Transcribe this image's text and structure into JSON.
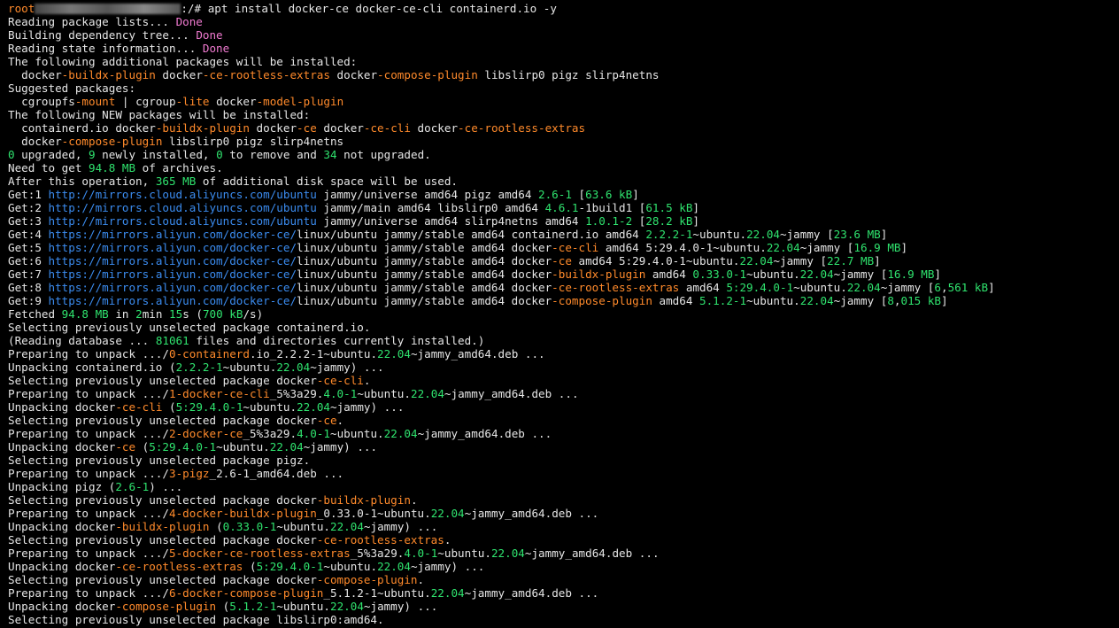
{
  "colors": {
    "background": "#000000",
    "text": "#e6e6e6",
    "orange": "#ff8a2b",
    "green": "#2fe36e",
    "blue": "#3b8cf0",
    "pink": "#f07ad0"
  },
  "prompt": {
    "user": "root",
    "suffix": ":/# ",
    "command": "apt install docker-ce docker-ce-cli containerd.io -y"
  },
  "lines": [
    [
      [
        "Reading package lists... ",
        "w"
      ],
      [
        "Done",
        "p"
      ]
    ],
    [
      [
        "Building dependency tree... ",
        "w"
      ],
      [
        "Done",
        "p"
      ]
    ],
    [
      [
        "Reading state information... ",
        "w"
      ],
      [
        "Done",
        "p"
      ]
    ],
    [
      [
        "The following additional packages will be installed:",
        "w"
      ]
    ],
    [
      [
        "  docker",
        "w"
      ],
      [
        "-buildx-plugin",
        "o"
      ],
      [
        " docker",
        "w"
      ],
      [
        "-ce-rootless-extras",
        "o"
      ],
      [
        " docker",
        "w"
      ],
      [
        "-compose-plugin",
        "o"
      ],
      [
        " libslirp0 pigz slirp4netns",
        "w"
      ]
    ],
    [
      [
        "Suggested packages:",
        "w"
      ]
    ],
    [
      [
        "  cgroupfs",
        "w"
      ],
      [
        "-mount",
        "o"
      ],
      [
        " | cgroup",
        "w"
      ],
      [
        "-lite",
        "o"
      ],
      [
        " docker",
        "w"
      ],
      [
        "-model-plugin",
        "o"
      ]
    ],
    [
      [
        "The following NEW packages will be installed:",
        "w"
      ]
    ],
    [
      [
        "  containerd.io docker",
        "w"
      ],
      [
        "-buildx-plugin",
        "o"
      ],
      [
        " docker",
        "w"
      ],
      [
        "-ce",
        "o"
      ],
      [
        " docker",
        "w"
      ],
      [
        "-ce-cli",
        "o"
      ],
      [
        " docker",
        "w"
      ],
      [
        "-ce-rootless-extras",
        "o"
      ]
    ],
    [
      [
        "  docker",
        "w"
      ],
      [
        "-compose-plugin",
        "o"
      ],
      [
        " libslirp0 pigz slirp4netns",
        "w"
      ]
    ],
    [
      [
        "0",
        "g"
      ],
      [
        " upgraded, ",
        "w"
      ],
      [
        "9",
        "g"
      ],
      [
        " newly installed, ",
        "w"
      ],
      [
        "0",
        "g"
      ],
      [
        " to remove and ",
        "w"
      ],
      [
        "34",
        "g"
      ],
      [
        " not upgraded.",
        "w"
      ]
    ],
    [
      [
        "Need to get ",
        "w"
      ],
      [
        "94.8 MB",
        "g"
      ],
      [
        " of archives.",
        "w"
      ]
    ],
    [
      [
        "After this operation, ",
        "w"
      ],
      [
        "365 MB",
        "g"
      ],
      [
        " of additional disk space will be used.",
        "w"
      ]
    ],
    [
      [
        "Get:1 ",
        "w"
      ],
      [
        "http://mirrors.cloud.aliyuncs.com/ubuntu",
        "b"
      ],
      [
        " jammy/universe amd64 pigz amd64 ",
        "w"
      ],
      [
        "2.6-1",
        "g"
      ],
      [
        " [",
        "w"
      ],
      [
        "63.6 kB",
        "g"
      ],
      [
        "]",
        "w"
      ]
    ],
    [
      [
        "Get:2 ",
        "w"
      ],
      [
        "http://mirrors.cloud.aliyuncs.com/ubuntu",
        "b"
      ],
      [
        " jammy/main amd64 libslirp0 amd64 ",
        "w"
      ],
      [
        "4.6.1",
        "g"
      ],
      [
        "-1build1 [",
        "w"
      ],
      [
        "61.5 kB",
        "g"
      ],
      [
        "]",
        "w"
      ]
    ],
    [
      [
        "Get:3 ",
        "w"
      ],
      [
        "http://mirrors.cloud.aliyuncs.com/ubuntu",
        "b"
      ],
      [
        " jammy/universe amd64 slirp4netns amd64 ",
        "w"
      ],
      [
        "1.0.1-2",
        "g"
      ],
      [
        " [",
        "w"
      ],
      [
        "28.2 kB",
        "g"
      ],
      [
        "]",
        "w"
      ]
    ],
    [
      [
        "Get:4 ",
        "w"
      ],
      [
        "https://mirrors.aliyun.com/docker-ce/",
        "b"
      ],
      [
        "linux/ubuntu jammy/stable amd64 containerd.io amd64 ",
        "w"
      ],
      [
        "2.2.2-1",
        "g"
      ],
      [
        "~ubuntu.",
        "w"
      ],
      [
        "22.04",
        "g"
      ],
      [
        "~jammy [",
        "w"
      ],
      [
        "23.6 MB",
        "g"
      ],
      [
        "]",
        "w"
      ]
    ],
    [
      [
        "Get:5 ",
        "w"
      ],
      [
        "https://mirrors.aliyun.com/docker-ce/",
        "b"
      ],
      [
        "linux/ubuntu jammy/stable amd64 docker",
        "w"
      ],
      [
        "-ce-cli",
        "o"
      ],
      [
        " amd64 5:29.4.0-1~ubuntu.",
        "w"
      ],
      [
        "22.04",
        "g"
      ],
      [
        "~jammy [",
        "w"
      ],
      [
        "16.9 MB",
        "g"
      ],
      [
        "]",
        "w"
      ]
    ],
    [
      [
        "Get:6 ",
        "w"
      ],
      [
        "https://mirrors.aliyun.com/docker-ce/",
        "b"
      ],
      [
        "linux/ubuntu jammy/stable amd64 docker",
        "w"
      ],
      [
        "-ce",
        "o"
      ],
      [
        " amd64 5:29.4.0-1~ubuntu.",
        "w"
      ],
      [
        "22.04",
        "g"
      ],
      [
        "~jammy [",
        "w"
      ],
      [
        "22.7 MB",
        "g"
      ],
      [
        "]",
        "w"
      ]
    ],
    [
      [
        "Get:7 ",
        "w"
      ],
      [
        "https://mirrors.aliyun.com/docker-ce/",
        "b"
      ],
      [
        "linux/ubuntu jammy/stable amd64 docker",
        "w"
      ],
      [
        "-buildx-plugin",
        "o"
      ],
      [
        " amd64 ",
        "w"
      ],
      [
        "0.33.0-1",
        "g"
      ],
      [
        "~ubuntu.",
        "w"
      ],
      [
        "22.04",
        "g"
      ],
      [
        "~jammy [",
        "w"
      ],
      [
        "16.9 MB",
        "g"
      ],
      [
        "]",
        "w"
      ]
    ],
    [
      [
        "Get:8 ",
        "w"
      ],
      [
        "https://mirrors.aliyun.com/docker-ce/",
        "b"
      ],
      [
        "linux/ubuntu jammy/stable amd64 docker",
        "w"
      ],
      [
        "-ce-rootless-extras",
        "o"
      ],
      [
        " amd64 ",
        "w"
      ],
      [
        "5:29.4.0-1",
        "g"
      ],
      [
        "~ubuntu.",
        "w"
      ],
      [
        "22.04",
        "g"
      ],
      [
        "~jammy [",
        "w"
      ],
      [
        "6",
        "g"
      ],
      [
        ",",
        "w"
      ],
      [
        "561 kB",
        "g"
      ],
      [
        "]",
        "w"
      ]
    ],
    [
      [
        "Get:9 ",
        "w"
      ],
      [
        "https://mirrors.aliyun.com/docker-ce/",
        "b"
      ],
      [
        "linux/ubuntu jammy/stable amd64 docker",
        "w"
      ],
      [
        "-compose-plugin",
        "o"
      ],
      [
        " amd64 ",
        "w"
      ],
      [
        "5.1.2-1",
        "g"
      ],
      [
        "~ubuntu.",
        "w"
      ],
      [
        "22.04",
        "g"
      ],
      [
        "~jammy [",
        "w"
      ],
      [
        "8",
        "g"
      ],
      [
        ",",
        "w"
      ],
      [
        "015 kB",
        "g"
      ],
      [
        "]",
        "w"
      ]
    ],
    [
      [
        "Fetched ",
        "w"
      ],
      [
        "94.8 MB",
        "g"
      ],
      [
        " in ",
        "w"
      ],
      [
        "2",
        "g"
      ],
      [
        "min ",
        "w"
      ],
      [
        "15",
        "g"
      ],
      [
        "s (",
        "w"
      ],
      [
        "700 kB",
        "g"
      ],
      [
        "/s)",
        "w"
      ]
    ],
    [
      [
        "Selecting previously unselected package containerd.io.",
        "w"
      ]
    ],
    [
      [
        "(Reading database ... ",
        "w"
      ],
      [
        "81061",
        "g"
      ],
      [
        " files and directories currently installed.)",
        "w"
      ]
    ],
    [
      [
        "Preparing to unpack .../",
        "w"
      ],
      [
        "0-containerd",
        "o"
      ],
      [
        ".io_2.2.2-1~ubuntu.",
        "w"
      ],
      [
        "22.04",
        "g"
      ],
      [
        "~jammy_amd64.deb ...",
        "w"
      ]
    ],
    [
      [
        "Unpacking containerd.io (",
        "w"
      ],
      [
        "2.2.2-1",
        "g"
      ],
      [
        "~ubuntu.",
        "w"
      ],
      [
        "22.04",
        "g"
      ],
      [
        "~jammy) ...",
        "w"
      ]
    ],
    [
      [
        "Selecting previously unselected package docker",
        "w"
      ],
      [
        "-ce-cli",
        "o"
      ],
      [
        ".",
        "w"
      ]
    ],
    [
      [
        "Preparing to unpack .../",
        "w"
      ],
      [
        "1-docker-ce-cli",
        "o"
      ],
      [
        "_5%3a29.",
        "w"
      ],
      [
        "4.0-1",
        "g"
      ],
      [
        "~ubuntu.",
        "w"
      ],
      [
        "22.04",
        "g"
      ],
      [
        "~jammy_amd64.deb ...",
        "w"
      ]
    ],
    [
      [
        "Unpacking docker",
        "w"
      ],
      [
        "-ce-cli",
        "o"
      ],
      [
        " (",
        "w"
      ],
      [
        "5:29.4.0-1",
        "g"
      ],
      [
        "~ubuntu.",
        "w"
      ],
      [
        "22.04",
        "g"
      ],
      [
        "~jammy) ...",
        "w"
      ]
    ],
    [
      [
        "Selecting previously unselected package docker",
        "w"
      ],
      [
        "-ce",
        "o"
      ],
      [
        ".",
        "w"
      ]
    ],
    [
      [
        "Preparing to unpack .../",
        "w"
      ],
      [
        "2-docker-ce",
        "o"
      ],
      [
        "_5%3a29.",
        "w"
      ],
      [
        "4.0-1",
        "g"
      ],
      [
        "~ubuntu.",
        "w"
      ],
      [
        "22.04",
        "g"
      ],
      [
        "~jammy_amd64.deb ...",
        "w"
      ]
    ],
    [
      [
        "Unpacking docker",
        "w"
      ],
      [
        "-ce",
        "o"
      ],
      [
        " (",
        "w"
      ],
      [
        "5:29.4.0-1",
        "g"
      ],
      [
        "~ubuntu.",
        "w"
      ],
      [
        "22.04",
        "g"
      ],
      [
        "~jammy) ...",
        "w"
      ]
    ],
    [
      [
        "Selecting previously unselected package pigz.",
        "w"
      ]
    ],
    [
      [
        "Preparing to unpack .../",
        "w"
      ],
      [
        "3-pigz",
        "o"
      ],
      [
        "_2.6-1_amd64.deb ...",
        "w"
      ]
    ],
    [
      [
        "Unpacking pigz (",
        "w"
      ],
      [
        "2.6-1",
        "g"
      ],
      [
        ") ...",
        "w"
      ]
    ],
    [
      [
        "Selecting previously unselected package docker",
        "w"
      ],
      [
        "-buildx-plugin",
        "o"
      ],
      [
        ".",
        "w"
      ]
    ],
    [
      [
        "Preparing to unpack .../",
        "w"
      ],
      [
        "4-docker-buildx-plugin",
        "o"
      ],
      [
        "_0.33.0-1~ubuntu.",
        "w"
      ],
      [
        "22.04",
        "g"
      ],
      [
        "~jammy_amd64.deb ...",
        "w"
      ]
    ],
    [
      [
        "Unpacking docker",
        "w"
      ],
      [
        "-buildx-plugin",
        "o"
      ],
      [
        " (",
        "w"
      ],
      [
        "0.33.0-1",
        "g"
      ],
      [
        "~ubuntu.",
        "w"
      ],
      [
        "22.04",
        "g"
      ],
      [
        "~jammy) ...",
        "w"
      ]
    ],
    [
      [
        "Selecting previously unselected package docker",
        "w"
      ],
      [
        "-ce-rootless-extras",
        "o"
      ],
      [
        ".",
        "w"
      ]
    ],
    [
      [
        "Preparing to unpack .../",
        "w"
      ],
      [
        "5-docker-ce-rootless-extras",
        "o"
      ],
      [
        "_5%3a29.",
        "w"
      ],
      [
        "4.0-1",
        "g"
      ],
      [
        "~ubuntu.",
        "w"
      ],
      [
        "22.04",
        "g"
      ],
      [
        "~jammy_amd64.deb ...",
        "w"
      ]
    ],
    [
      [
        "Unpacking docker",
        "w"
      ],
      [
        "-ce-rootless-extras",
        "o"
      ],
      [
        " (",
        "w"
      ],
      [
        "5:29.4.0-1",
        "g"
      ],
      [
        "~ubuntu.",
        "w"
      ],
      [
        "22.04",
        "g"
      ],
      [
        "~jammy) ...",
        "w"
      ]
    ],
    [
      [
        "Selecting previously unselected package docker",
        "w"
      ],
      [
        "-compose-plugin",
        "o"
      ],
      [
        ".",
        "w"
      ]
    ],
    [
      [
        "Preparing to unpack .../",
        "w"
      ],
      [
        "6-docker-compose-plugin",
        "o"
      ],
      [
        "_5.1.2-1~ubuntu.",
        "w"
      ],
      [
        "22.04",
        "g"
      ],
      [
        "~jammy_amd64.deb ...",
        "w"
      ]
    ],
    [
      [
        "Unpacking docker",
        "w"
      ],
      [
        "-compose-plugin",
        "o"
      ],
      [
        " (",
        "w"
      ],
      [
        "5.1.2-1",
        "g"
      ],
      [
        "~ubuntu.",
        "w"
      ],
      [
        "22.04",
        "g"
      ],
      [
        "~jammy) ...",
        "w"
      ]
    ],
    [
      [
        "Selecting previously unselected package libslirp0:amd64.",
        "w"
      ]
    ]
  ]
}
